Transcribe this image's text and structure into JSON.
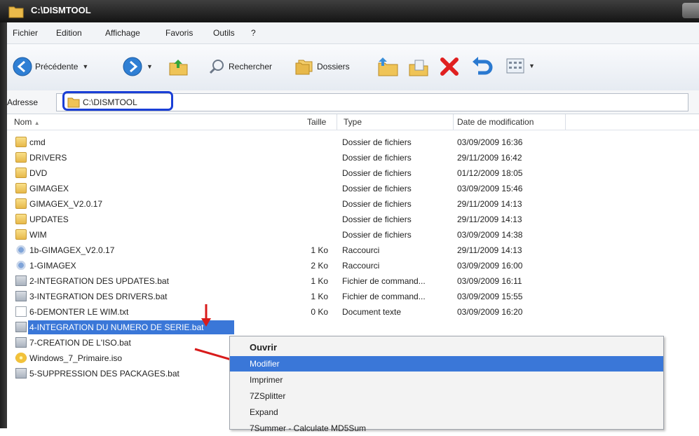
{
  "window": {
    "title": "C:\\DISMTOOL"
  },
  "menubar": {
    "items": [
      "Fichier",
      "Edition",
      "Affichage",
      "Favoris",
      "Outils",
      "?"
    ]
  },
  "toolbar": {
    "back_label": "Précédente",
    "search_label": "Rechercher",
    "folders_label": "Dossiers"
  },
  "address": {
    "label": "Adresse",
    "value": "C:\\DISMTOOL"
  },
  "columns": {
    "name": "Nom",
    "size": "Taille",
    "type": "Type",
    "date": "Date de modification"
  },
  "files": [
    {
      "name": "cmd",
      "size": "",
      "type": "Dossier de fichiers",
      "date": "03/09/2009 16:36",
      "icon": "folder-icon"
    },
    {
      "name": "DRIVERS",
      "size": "",
      "type": "Dossier de fichiers",
      "date": "29/11/2009 16:42",
      "icon": "folder-icon"
    },
    {
      "name": "DVD",
      "size": "",
      "type": "Dossier de fichiers",
      "date": "01/12/2009 18:05",
      "icon": "folder-icon"
    },
    {
      "name": "GIMAGEX",
      "size": "",
      "type": "Dossier de fichiers",
      "date": "03/09/2009 15:46",
      "icon": "folder-icon"
    },
    {
      "name": "GIMAGEX_V2.0.17",
      "size": "",
      "type": "Dossier de fichiers",
      "date": "29/11/2009 14:13",
      "icon": "folder-icon"
    },
    {
      "name": "UPDATES",
      "size": "",
      "type": "Dossier de fichiers",
      "date": "29/11/2009 14:13",
      "icon": "folder-icon"
    },
    {
      "name": "WIM",
      "size": "",
      "type": "Dossier de fichiers",
      "date": "03/09/2009 14:38",
      "icon": "folder-icon"
    },
    {
      "name": "1b-GIMAGEX_V2.0.17",
      "size": "1 Ko",
      "type": "Raccourci",
      "date": "29/11/2009 14:13",
      "icon": "shortcut-icon"
    },
    {
      "name": "1-GIMAGEX",
      "size": "2 Ko",
      "type": "Raccourci",
      "date": "03/09/2009 16:00",
      "icon": "shortcut-icon"
    },
    {
      "name": "2-INTEGRATION DES UPDATES.bat",
      "size": "1 Ko",
      "type": "Fichier de command...",
      "date": "03/09/2009 16:11",
      "icon": "batch-file-icon"
    },
    {
      "name": "3-INTEGRATION DES DRIVERS.bat",
      "size": "1 Ko",
      "type": "Fichier de command...",
      "date": "03/09/2009 15:55",
      "icon": "batch-file-icon"
    },
    {
      "name": "6-DEMONTER LE WIM.txt",
      "size": "0 Ko",
      "type": "Document texte",
      "date": "03/09/2009 16:20",
      "icon": "text-file-icon"
    },
    {
      "name": "4-INTEGRATION DU NUMERO DE SERIE.bat",
      "size": "",
      "type": "",
      "date": "",
      "icon": "batch-file-icon",
      "selected": true
    },
    {
      "name": "7-CREATION DE L'ISO.bat",
      "size": "",
      "type": "",
      "date": "",
      "icon": "batch-file-icon"
    },
    {
      "name": "Windows_7_Primaire.iso",
      "size": "",
      "type": "",
      "date": "",
      "icon": "iso-file-icon"
    },
    {
      "name": "5-SUPPRESSION DES PACKAGES.bat",
      "size": "",
      "type": "",
      "date": "",
      "icon": "batch-file-icon"
    }
  ],
  "context_menu": {
    "items": [
      "Ouvrir",
      "Modifier",
      "Imprimer",
      "7ZSplitter",
      "Expand",
      "7Summer - Calculate MD5Sum"
    ],
    "highlighted": "Modifier"
  },
  "colors": {
    "highlight": "#3a77d8",
    "annotation_box": "#1a3fd6",
    "annotation_arrow": "#d81b1b"
  }
}
